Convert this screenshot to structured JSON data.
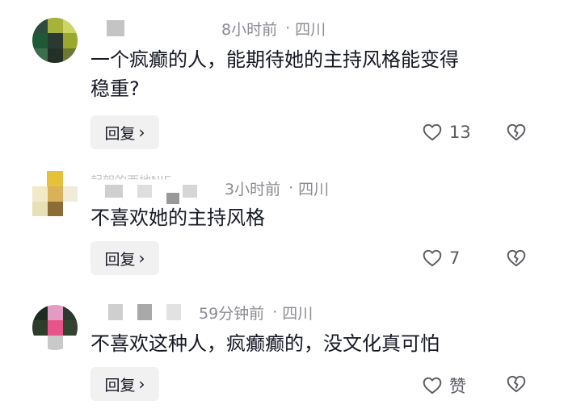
{
  "comments": [
    {
      "time": "8小时前",
      "location": "四川",
      "text_line1": "一个疯癫的人，能期待她的主持风格能变得",
      "text_line2": "稳重?",
      "reply_label": "回复",
      "likes": "13"
    },
    {
      "username_partial": "起架的西地NIE",
      "time": "3小时前",
      "location": "四川",
      "text_line1": "不喜欢她的主持风格",
      "reply_label": "回复",
      "likes": "7"
    },
    {
      "time": "59分钟前",
      "location": "四川",
      "text_line1": "不喜欢这种人，疯癫癫的，没文化真可怕",
      "reply_label": "回复",
      "likes": "赞"
    }
  ],
  "separator": "·",
  "icons": {
    "like": "heart-outline-icon",
    "dislike": "broken-heart-icon",
    "reply_chevron": "chevron-right-icon"
  }
}
